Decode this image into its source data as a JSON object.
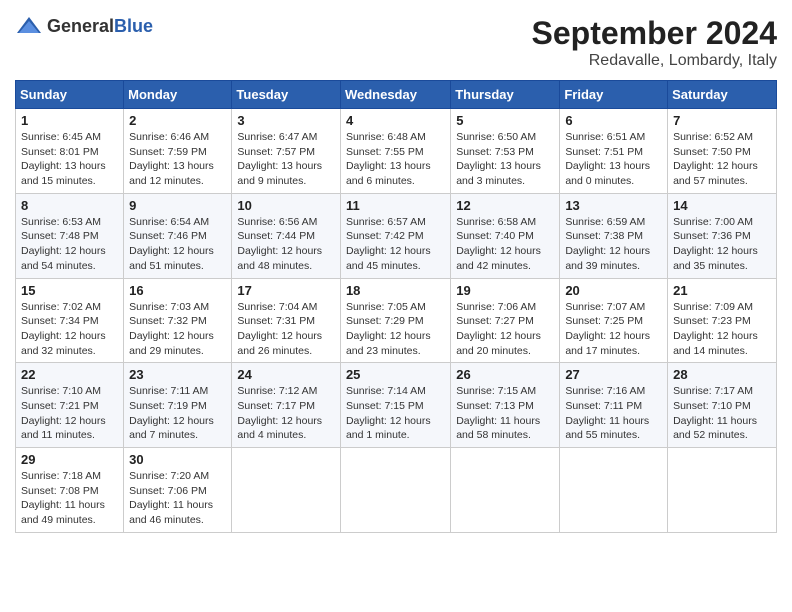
{
  "logo": {
    "general": "General",
    "blue": "Blue"
  },
  "title": "September 2024",
  "location": "Redavalle, Lombardy, Italy",
  "days_header": [
    "Sunday",
    "Monday",
    "Tuesday",
    "Wednesday",
    "Thursday",
    "Friday",
    "Saturday"
  ],
  "weeks": [
    [
      {
        "day": "1",
        "info": "Sunrise: 6:45 AM\nSunset: 8:01 PM\nDaylight: 13 hours\nand 15 minutes."
      },
      {
        "day": "2",
        "info": "Sunrise: 6:46 AM\nSunset: 7:59 PM\nDaylight: 13 hours\nand 12 minutes."
      },
      {
        "day": "3",
        "info": "Sunrise: 6:47 AM\nSunset: 7:57 PM\nDaylight: 13 hours\nand 9 minutes."
      },
      {
        "day": "4",
        "info": "Sunrise: 6:48 AM\nSunset: 7:55 PM\nDaylight: 13 hours\nand 6 minutes."
      },
      {
        "day": "5",
        "info": "Sunrise: 6:50 AM\nSunset: 7:53 PM\nDaylight: 13 hours\nand 3 minutes."
      },
      {
        "day": "6",
        "info": "Sunrise: 6:51 AM\nSunset: 7:51 PM\nDaylight: 13 hours\nand 0 minutes."
      },
      {
        "day": "7",
        "info": "Sunrise: 6:52 AM\nSunset: 7:50 PM\nDaylight: 12 hours\nand 57 minutes."
      }
    ],
    [
      {
        "day": "8",
        "info": "Sunrise: 6:53 AM\nSunset: 7:48 PM\nDaylight: 12 hours\nand 54 minutes."
      },
      {
        "day": "9",
        "info": "Sunrise: 6:54 AM\nSunset: 7:46 PM\nDaylight: 12 hours\nand 51 minutes."
      },
      {
        "day": "10",
        "info": "Sunrise: 6:56 AM\nSunset: 7:44 PM\nDaylight: 12 hours\nand 48 minutes."
      },
      {
        "day": "11",
        "info": "Sunrise: 6:57 AM\nSunset: 7:42 PM\nDaylight: 12 hours\nand 45 minutes."
      },
      {
        "day": "12",
        "info": "Sunrise: 6:58 AM\nSunset: 7:40 PM\nDaylight: 12 hours\nand 42 minutes."
      },
      {
        "day": "13",
        "info": "Sunrise: 6:59 AM\nSunset: 7:38 PM\nDaylight: 12 hours\nand 39 minutes."
      },
      {
        "day": "14",
        "info": "Sunrise: 7:00 AM\nSunset: 7:36 PM\nDaylight: 12 hours\nand 35 minutes."
      }
    ],
    [
      {
        "day": "15",
        "info": "Sunrise: 7:02 AM\nSunset: 7:34 PM\nDaylight: 12 hours\nand 32 minutes."
      },
      {
        "day": "16",
        "info": "Sunrise: 7:03 AM\nSunset: 7:32 PM\nDaylight: 12 hours\nand 29 minutes."
      },
      {
        "day": "17",
        "info": "Sunrise: 7:04 AM\nSunset: 7:31 PM\nDaylight: 12 hours\nand 26 minutes."
      },
      {
        "day": "18",
        "info": "Sunrise: 7:05 AM\nSunset: 7:29 PM\nDaylight: 12 hours\nand 23 minutes."
      },
      {
        "day": "19",
        "info": "Sunrise: 7:06 AM\nSunset: 7:27 PM\nDaylight: 12 hours\nand 20 minutes."
      },
      {
        "day": "20",
        "info": "Sunrise: 7:07 AM\nSunset: 7:25 PM\nDaylight: 12 hours\nand 17 minutes."
      },
      {
        "day": "21",
        "info": "Sunrise: 7:09 AM\nSunset: 7:23 PM\nDaylight: 12 hours\nand 14 minutes."
      }
    ],
    [
      {
        "day": "22",
        "info": "Sunrise: 7:10 AM\nSunset: 7:21 PM\nDaylight: 12 hours\nand 11 minutes."
      },
      {
        "day": "23",
        "info": "Sunrise: 7:11 AM\nSunset: 7:19 PM\nDaylight: 12 hours\nand 7 minutes."
      },
      {
        "day": "24",
        "info": "Sunrise: 7:12 AM\nSunset: 7:17 PM\nDaylight: 12 hours\nand 4 minutes."
      },
      {
        "day": "25",
        "info": "Sunrise: 7:14 AM\nSunset: 7:15 PM\nDaylight: 12 hours\nand 1 minute."
      },
      {
        "day": "26",
        "info": "Sunrise: 7:15 AM\nSunset: 7:13 PM\nDaylight: 11 hours\nand 58 minutes."
      },
      {
        "day": "27",
        "info": "Sunrise: 7:16 AM\nSunset: 7:11 PM\nDaylight: 11 hours\nand 55 minutes."
      },
      {
        "day": "28",
        "info": "Sunrise: 7:17 AM\nSunset: 7:10 PM\nDaylight: 11 hours\nand 52 minutes."
      }
    ],
    [
      {
        "day": "29",
        "info": "Sunrise: 7:18 AM\nSunset: 7:08 PM\nDaylight: 11 hours\nand 49 minutes."
      },
      {
        "day": "30",
        "info": "Sunrise: 7:20 AM\nSunset: 7:06 PM\nDaylight: 11 hours\nand 46 minutes."
      },
      {
        "day": "",
        "info": ""
      },
      {
        "day": "",
        "info": ""
      },
      {
        "day": "",
        "info": ""
      },
      {
        "day": "",
        "info": ""
      },
      {
        "day": "",
        "info": ""
      }
    ]
  ]
}
